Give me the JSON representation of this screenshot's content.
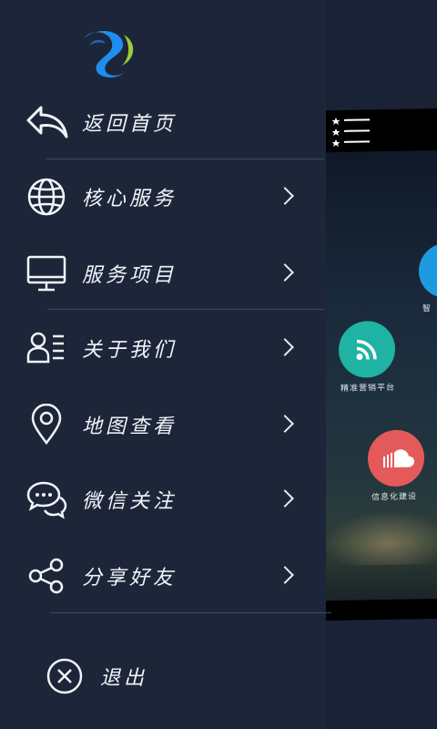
{
  "drawer": {
    "logo_name": "brand-logo",
    "items": [
      {
        "label": "返回首页",
        "icon": "back-arrow-icon",
        "has_chevron": false
      },
      {
        "label": "核心服务",
        "icon": "globe-icon",
        "has_chevron": true
      },
      {
        "label": "服务项目",
        "icon": "monitor-icon",
        "has_chevron": true
      },
      {
        "label": "关于我们",
        "icon": "user-card-icon",
        "has_chevron": true
      },
      {
        "label": "地图查看",
        "icon": "location-pin-icon",
        "has_chevron": true
      },
      {
        "label": "微信关注",
        "icon": "chat-bubbles-icon",
        "has_chevron": true
      },
      {
        "label": "分享好友",
        "icon": "share-icon",
        "has_chevron": true
      }
    ],
    "exit_label": "退出"
  },
  "preview": {
    "bubbles": [
      {
        "label": "智",
        "color": "#1e9be0",
        "icon": "info-icon"
      },
      {
        "label": "精准营销平台",
        "color": "#1fb3a3",
        "icon": "rss-icon"
      },
      {
        "label": "信息化建设",
        "color": "#e45a5a",
        "icon": "cloud-icon"
      }
    ]
  },
  "colors": {
    "drawer_bg": "#1d2639",
    "text": "#f2f4f8",
    "divider": "#3a4868",
    "logo_blue": "#1e8ef0",
    "logo_green": "#9acd3a"
  }
}
